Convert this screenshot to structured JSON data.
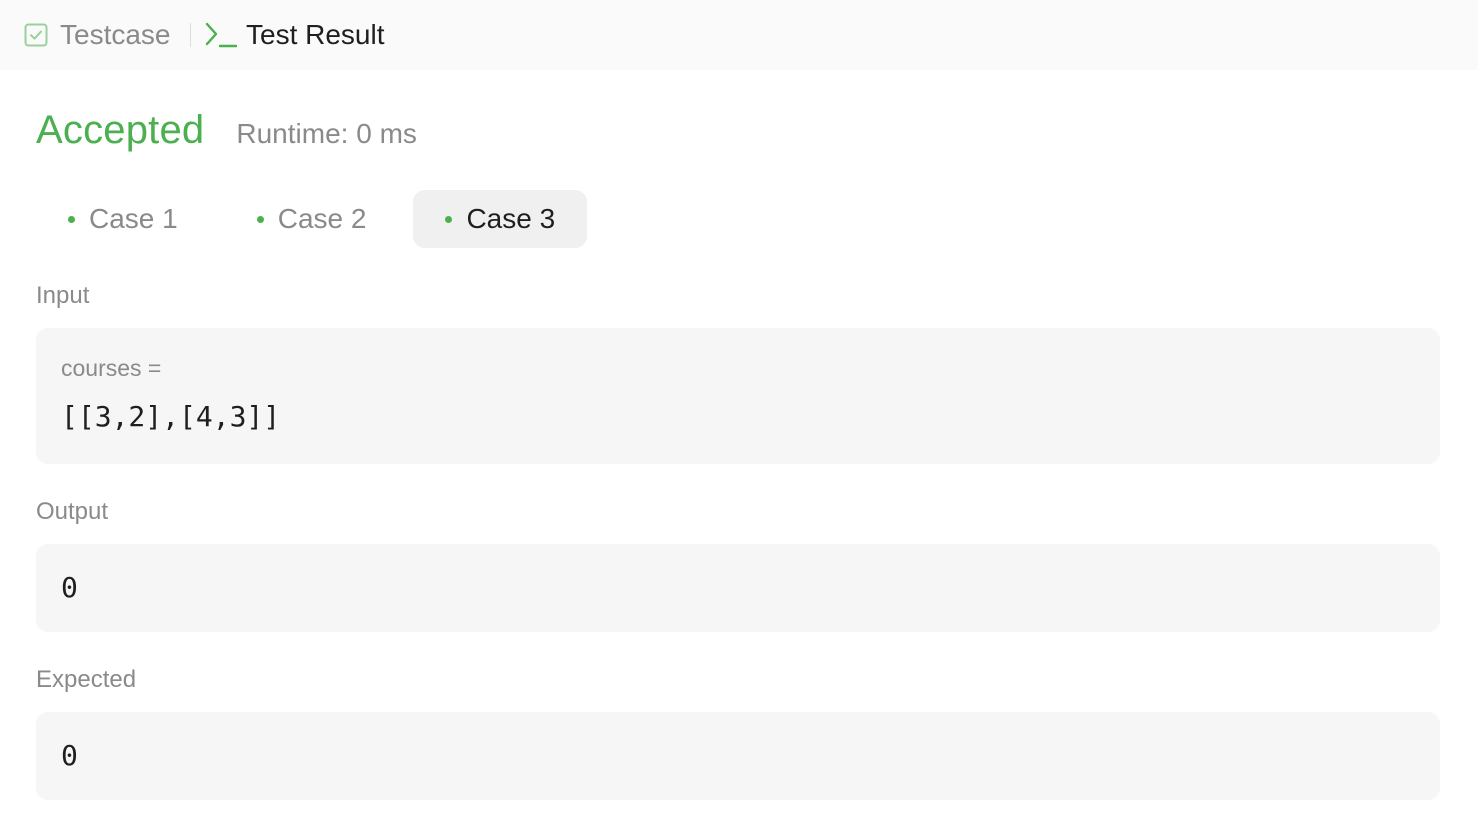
{
  "tabs": {
    "testcase_label": "Testcase",
    "result_label": "Test Result"
  },
  "result": {
    "status": "Accepted",
    "runtime": "Runtime: 0 ms"
  },
  "cases": [
    {
      "label": "Case 1"
    },
    {
      "label": "Case 2"
    },
    {
      "label": "Case 3"
    }
  ],
  "selected_case": "Case 3",
  "input": {
    "label": "Input",
    "var_name": "courses =",
    "value": "[[3,2],[4,3]]"
  },
  "output": {
    "label": "Output",
    "value": "0"
  },
  "expected": {
    "label": "Expected",
    "value": "0"
  },
  "colors": {
    "accent": "#4caf50",
    "muted_text": "#8a8a8a",
    "box_bg": "#f6f6f6"
  }
}
